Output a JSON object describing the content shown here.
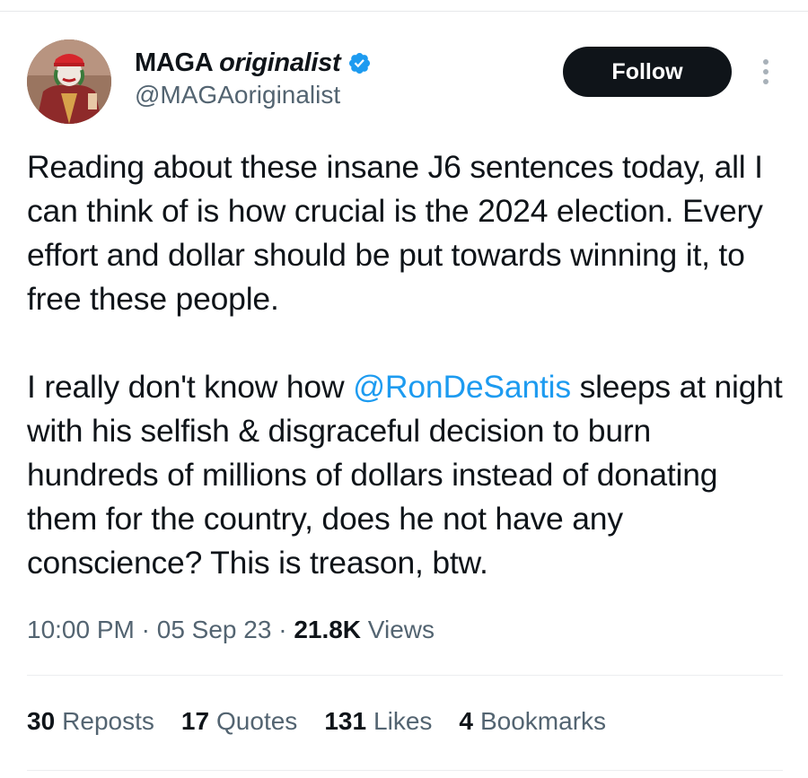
{
  "author": {
    "display_name_part1": "MAGA ",
    "display_name_part2": "originalist",
    "handle": "@MAGAoriginalist",
    "verified": true,
    "verified_color": "#1d9bf0"
  },
  "follow_label": "Follow",
  "tweet": {
    "p1": "Reading about these insane J6 sentences today, all I can think of is how crucial is the 2024 election. Every effort and dollar should be put towards winning it, to free these people.",
    "p2_before": "I really don't know how ",
    "p2_mention": "@RonDeSantis",
    "p2_after": " sleeps at night with his selfish & disgraceful decision to burn hundreds of millions of dollars instead of donating them for the country, does he not have any conscience? This is treason, btw."
  },
  "meta": {
    "time": "10:00 PM",
    "sep1": " · ",
    "date": "05 Sep 23",
    "sep2": " · ",
    "views_count": "21.8K",
    "views_label": " Views"
  },
  "stats": [
    {
      "count": "30",
      "label": "Reposts"
    },
    {
      "count": "17",
      "label": "Quotes"
    },
    {
      "count": "131",
      "label": "Likes"
    },
    {
      "count": "4",
      "label": "Bookmarks"
    }
  ],
  "colors": {
    "text": "#0f1419",
    "secondary": "#536471",
    "link": "#1d9bf0",
    "button_bg": "#0f1419"
  }
}
